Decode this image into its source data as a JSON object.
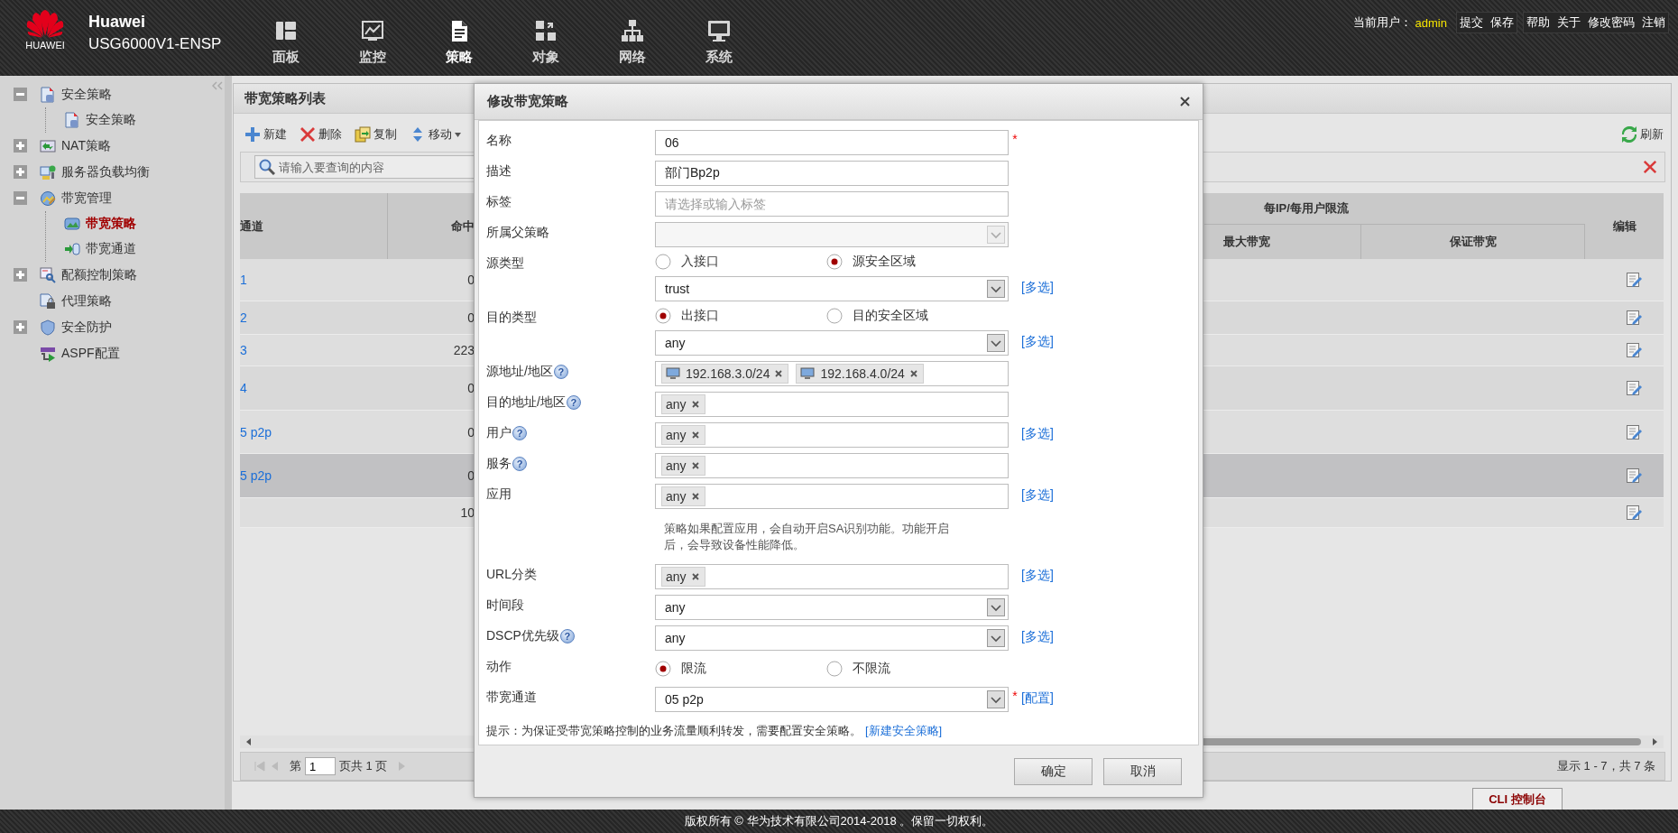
{
  "header": {
    "logo_text": "HUAWEI",
    "brand": "Huawei",
    "model": "USG6000V1-ENSP"
  },
  "nav": [
    {
      "label": "面板",
      "selected": false
    },
    {
      "label": "监控",
      "selected": false
    },
    {
      "label": "策略",
      "selected": true
    },
    {
      "label": "对象",
      "selected": false
    },
    {
      "label": "网络",
      "selected": false
    },
    {
      "label": "系统",
      "selected": false
    }
  ],
  "user_bar": {
    "label": "当前用户：",
    "user": "admin",
    "groups": [
      [
        "提交",
        "保存"
      ],
      [
        "帮助",
        "关于",
        "修改密码",
        "注销"
      ]
    ]
  },
  "sidebar": {
    "items": [
      {
        "kind": "group",
        "label": "安全策略",
        "expanded": true,
        "selected": false,
        "children": [
          {
            "label": "安全策略",
            "selected": false
          }
        ]
      },
      {
        "kind": "group",
        "label": "NAT策略",
        "expanded": false,
        "selected": false
      },
      {
        "kind": "group",
        "label": "服务器负载均衡",
        "expanded": false,
        "selected": false
      },
      {
        "kind": "group",
        "label": "带宽管理",
        "expanded": true,
        "selected": false,
        "children": [
          {
            "label": "带宽策略",
            "selected": true
          },
          {
            "label": "带宽通道",
            "selected": false
          }
        ]
      },
      {
        "kind": "group",
        "label": "配额控制策略",
        "expanded": false,
        "selected": false
      },
      {
        "kind": "leaf",
        "label": "代理策略",
        "selected": false
      },
      {
        "kind": "group",
        "label": "安全防护",
        "expanded": false,
        "selected": false
      },
      {
        "kind": "leaf",
        "label": "ASPF配置",
        "selected": false
      }
    ]
  },
  "panel": {
    "title": "带宽策略列表",
    "toolbar": [
      {
        "label": "新建",
        "dropdown": false
      },
      {
        "label": "删除",
        "dropdown": false
      },
      {
        "label": "复制",
        "dropdown": false
      },
      {
        "label": "移动",
        "dropdown": true
      }
    ],
    "refresh": "刷新",
    "search_placeholder": "请输入要查询的内容"
  },
  "table": {
    "left_headers": [
      "通道",
      "命中"
    ],
    "group_header": "每IP/每用户限流",
    "sub_headers": [
      "最大带宽",
      "保证带宽"
    ],
    "edit_header": "编辑",
    "rows": [
      {
        "channel": "1",
        "hits": "0",
        "selected": false
      },
      {
        "channel": "2",
        "hits": "0",
        "selected": false
      },
      {
        "channel": "3",
        "hits": "223",
        "selected": false
      },
      {
        "channel": "4",
        "hits": "0",
        "selected": false
      },
      {
        "channel": "5 p2p",
        "hits": "0",
        "selected": false
      },
      {
        "channel": "5 p2p",
        "hits": "0",
        "selected": true
      },
      {
        "hits": "10",
        "selected": false
      }
    ]
  },
  "pager": {
    "page_label": "第",
    "page": "1",
    "total": "页共 1 页",
    "summary": "显示 1 - 7，共 7 条"
  },
  "dialog": {
    "title": "修改带宽策略",
    "fields": [
      {
        "kind": "text",
        "label": "名称",
        "value": "06",
        "required": "*"
      },
      {
        "kind": "text",
        "label": "描述",
        "value": "部门Bp2p"
      },
      {
        "kind": "text",
        "label": "标签",
        "placeholder": "请选择或输入标签"
      },
      {
        "kind": "select",
        "label": "所属父策略",
        "disabled": true
      },
      {
        "kind": "radio",
        "label": "源类型",
        "options": [
          {
            "label": "入接口",
            "selected": false
          },
          {
            "label": "源安全区域",
            "selected": true
          }
        ]
      },
      {
        "kind": "select",
        "value": "trust",
        "disabled": false,
        "link": "[多选]"
      },
      {
        "kind": "radio",
        "label": "目的类型",
        "options": [
          {
            "label": "出接口",
            "selected": true
          },
          {
            "label": "目的安全区域",
            "selected": false
          }
        ]
      },
      {
        "kind": "select",
        "value": "any",
        "disabled": false,
        "link": "[多选]"
      },
      {
        "kind": "tags",
        "label": "源地址/地区",
        "help": "?",
        "tags": [
          {
            "kind": "address",
            "text": "192.168.3.0/24"
          },
          {
            "kind": "address",
            "text": "192.168.4.0/24"
          }
        ]
      },
      {
        "kind": "tags",
        "label": "目的地址/地区",
        "help": "?",
        "tags": [
          {
            "kind": "plain",
            "text": "any"
          }
        ]
      },
      {
        "kind": "tags",
        "label": "用户",
        "help": "?",
        "tags": [
          {
            "kind": "plain",
            "text": "any"
          }
        ],
        "link": "[多选]"
      },
      {
        "kind": "tags",
        "label": "服务",
        "help": "?",
        "tags": [
          {
            "kind": "plain",
            "text": "any"
          }
        ]
      },
      {
        "kind": "tags",
        "label": "应用",
        "tags": [
          {
            "kind": "plain",
            "text": "any"
          }
        ],
        "link": "[多选]",
        "note": "策略如果配置应用，会自动开启SA识别功能。功能开启后，会导致设备性能降低。"
      },
      {
        "kind": "tags",
        "label": "URL分类",
        "tags": [
          {
            "kind": "plain",
            "text": "any"
          }
        ],
        "link": "[多选]"
      },
      {
        "kind": "select",
        "label": "时间段",
        "value": "any",
        "disabled": false
      },
      {
        "kind": "select",
        "label": "DSCP优先级",
        "help": "?",
        "value": "any",
        "disabled": false,
        "link": "[多选]"
      },
      {
        "kind": "radio",
        "label": "动作",
        "options": [
          {
            "label": "限流",
            "selected": true
          },
          {
            "label": "不限流",
            "selected": false
          }
        ]
      },
      {
        "kind": "select",
        "label": "带宽通道",
        "value": "05 p2p",
        "disabled": false,
        "required": "*",
        "link": "[配置]"
      }
    ],
    "hint": "提示：为保证受带宽策略控制的业务流量顺利转发，需要配置安全策略。",
    "hint_link": "[新建安全策略]",
    "buttons": [
      "确定",
      "取消"
    ]
  },
  "cli_tab": "CLI 控制台",
  "footer": "版权所有 © 华为技术有限公司2014-2018 。保留一切权利。"
}
